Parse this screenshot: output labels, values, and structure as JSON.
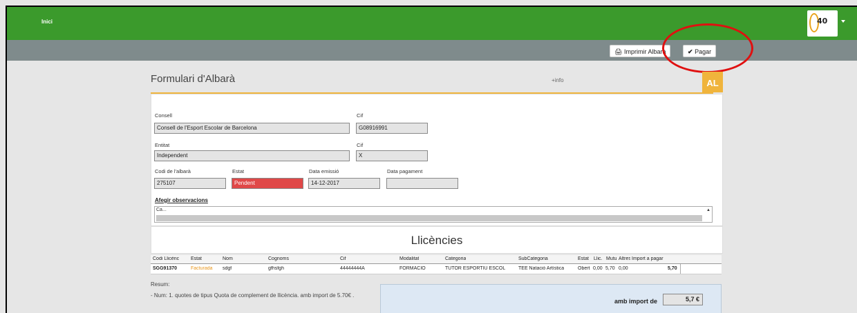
{
  "nav": {
    "home": "Inici",
    "logo_number": "40"
  },
  "toolbar": {
    "print_label": "Imprimir Albarà",
    "pay_label": "Pagar",
    "print_icon": "printer-icon",
    "pay_icon": "check-icon"
  },
  "panel": {
    "title": "Formulari d'Albarà",
    "info_link": "+info",
    "badge": "AL"
  },
  "form": {
    "consell_label": "Consell",
    "consell_value": "Consell de l'Esport Escolar de Barcelona",
    "cif1_label": "Cif",
    "cif1_value": "G08916991",
    "entitat_label": "Entitat",
    "entitat_value": "Independent",
    "cif2_label": "Cif",
    "cif2_value": "X",
    "codi_label": "Codi de l'albarà",
    "codi_value": "275107",
    "estat_label": "Estat",
    "estat_value": "Pendent",
    "emissio_label": "Data emissió",
    "emissio_value": "14-12-2017",
    "pagament_label": "Data pagament",
    "pagament_value": "",
    "obs_link": "Afegir observacions",
    "obs_text": "Ca...",
    "status_color": "#e04848"
  },
  "llicencies": {
    "title": "Llicències",
    "headers": [
      "Codi Llicènc",
      "Estat",
      "Nom",
      "Cognoms",
      "Cif",
      "Modalitat",
      "Categoria",
      "SubCategoria",
      "Estat",
      "Llic.",
      "Mutu",
      "Altres",
      "Import a pagar"
    ],
    "row": [
      "SGG91370",
      "Facturada",
      "sdgf",
      "gfhsfgh",
      "44444444A",
      "FORMACIÓ",
      "TUTOR ESPORTIU ESCOL",
      "TEE Natació Artística",
      "Obert",
      "0,00",
      "5,70",
      "0,00",
      "5,70"
    ]
  },
  "summary": {
    "resum_label": "Resum:",
    "resum_line": "- Num: 1. quotes de tipus Quota de complement de llicència. amb import de 5.70€ .",
    "import_label": "amb import de",
    "import_value": "5,7 €"
  }
}
